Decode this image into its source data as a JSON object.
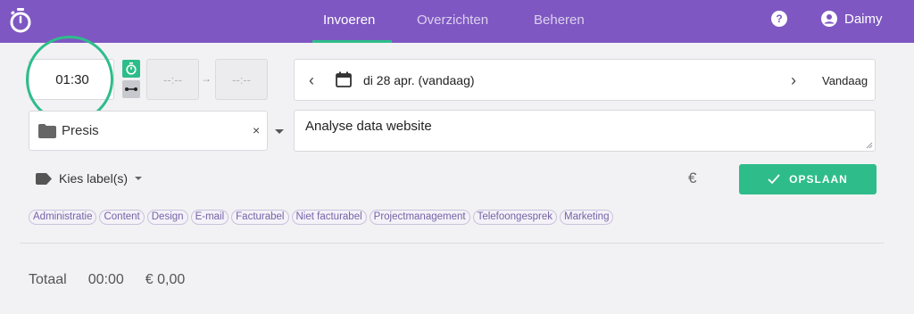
{
  "nav": {
    "tabs": [
      {
        "label": "Invoeren",
        "active": true
      },
      {
        "label": "Overzichten",
        "active": false
      },
      {
        "label": "Beheren",
        "active": false
      }
    ],
    "help_icon": "question-circle-icon",
    "user": {
      "icon": "user-circle-icon",
      "name": "Daimy"
    }
  },
  "entry": {
    "duration": "01:30",
    "start_placeholder": "--:--",
    "end_placeholder": "--:--",
    "arrow": "→",
    "project": "Presis",
    "clear": "×",
    "date_label": "di 28 apr. (vandaag)",
    "today_label": "Vandaag",
    "description": "Analyse data website",
    "labels_trigger": "Kies label(s)",
    "currency_symbol": "€",
    "save_label": "OPSLAAN"
  },
  "labels": [
    "Administratie",
    "Content",
    "Design",
    "E-mail",
    "Facturabel",
    "Niet facturabel",
    "Projectmanagement",
    "Telefoongesprek",
    "Marketing"
  ],
  "totals": {
    "label": "Totaal",
    "duration": "00:00",
    "amount": "€ 0,00"
  },
  "colors": {
    "brand": "#7e57c2",
    "accent": "#2ebd8a",
    "chip_text": "#7563a7"
  }
}
